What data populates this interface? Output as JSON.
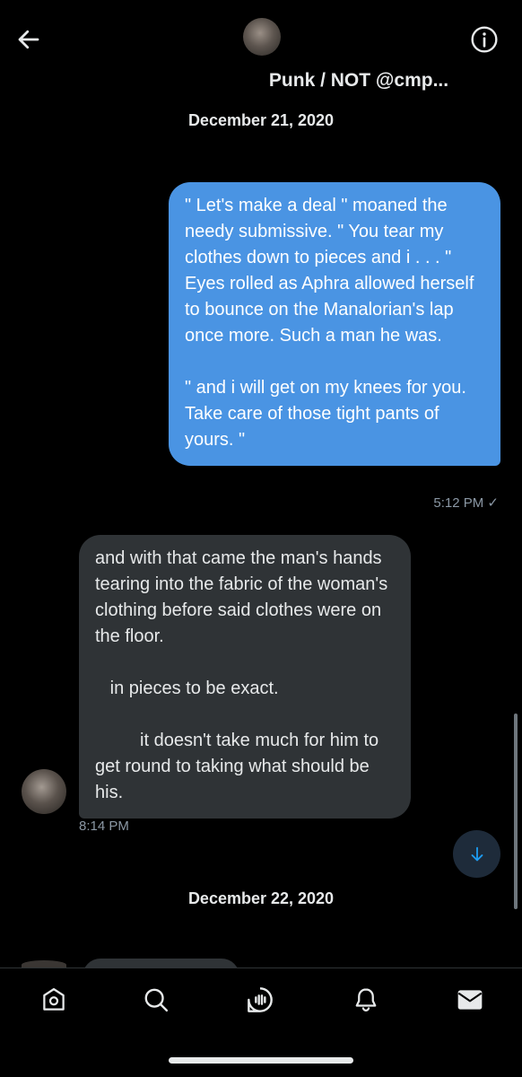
{
  "header": {
    "title": "Punk / NOT @cmp...",
    "back_icon": "arrow-left-icon",
    "info_icon": "info-circle-icon"
  },
  "conversation": {
    "date_1": "December 21, 2020",
    "outgoing_message": {
      "text": "\" Let's make a deal \" moaned the needy submissive. \" You tear my clothes down to pieces and i . . . \" Eyes rolled as Aphra allowed herself to bounce on the Manalorian's lap once more. Such a man he was.\n\n\" and i will get on my knees for you. Take care of those tight pants of yours. \"",
      "time": "5:12 PM ✓"
    },
    "incoming_message": {
      "text": "and with that came the man's hands tearing into the fabric of the woman's clothing before said clothes were on the floor.\n\n   in pieces to be exact.\n\n         it doesn't take much for him to get round to taking what should be his.",
      "time": "8:14 PM"
    },
    "date_2": "December 22, 2020"
  },
  "tabs": [
    {
      "icon": "home-icon"
    },
    {
      "icon": "search-icon"
    },
    {
      "icon": "spaces-icon"
    },
    {
      "icon": "notifications-icon"
    },
    {
      "icon": "messages-icon"
    }
  ],
  "colors": {
    "accent": "#1d9bf0",
    "outgoing_bubble": "#4a94e3",
    "incoming_bubble": "#2f3336",
    "background": "#000000"
  }
}
